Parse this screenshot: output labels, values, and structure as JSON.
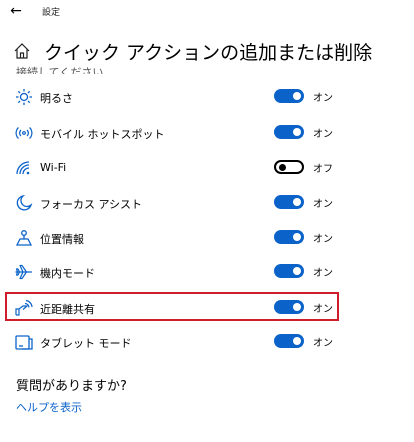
{
  "window": {
    "back_glyph": "←",
    "app_title": "設定"
  },
  "page": {
    "title": "クイック アクションの追加または削除"
  },
  "list": {
    "partial_item_label": "接続してください",
    "items": [
      {
        "icon": "brightness-icon",
        "label": "明るさ",
        "state": "オン",
        "on": true
      },
      {
        "icon": "mobile-hotspot-icon",
        "label": "モバイル ホットスポット",
        "state": "オン",
        "on": true
      },
      {
        "icon": "wifi-icon",
        "label": "Wi-Fi",
        "state": "オフ",
        "on": false
      },
      {
        "icon": "focus-assist-icon",
        "label": "フォーカス アシスト",
        "state": "オン",
        "on": true
      },
      {
        "icon": "location-icon",
        "label": "位置情報",
        "state": "オン",
        "on": true
      },
      {
        "icon": "airplane-mode-icon",
        "label": "機内モード",
        "state": "オン",
        "on": true
      },
      {
        "icon": "nearby-sharing-icon",
        "label": "近距離共有",
        "state": "オン",
        "on": true
      },
      {
        "icon": "tablet-mode-icon",
        "label": "タブレット モード",
        "state": "オン",
        "on": true
      }
    ]
  },
  "help": {
    "question": "質問がありますか?",
    "link": "ヘルプを表示"
  },
  "colors": {
    "accent": "#0b63c9",
    "highlight_border": "#cf1d2b"
  }
}
